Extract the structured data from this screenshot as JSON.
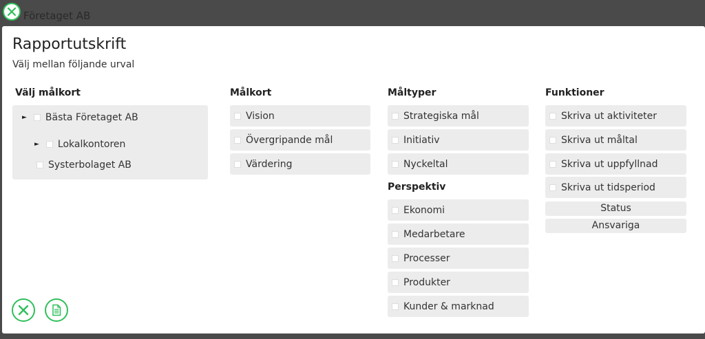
{
  "background": {
    "behind_text": "Företaget AB"
  },
  "dialog": {
    "title": "Rapportutskrift",
    "subtitle": "Välj mellan följande urval"
  },
  "colors": {
    "accent": "#2fbf5a",
    "panel": "#ececec",
    "overlay": "#4a4a4a"
  },
  "columns": {
    "scorecards": {
      "header": "Välj målkort",
      "tree": [
        {
          "label": "Bästa Företaget AB",
          "expandable": true,
          "checked": false
        },
        {
          "label": "Lokalkontoren",
          "expandable": true,
          "checked": false
        },
        {
          "label": "Systerbolaget AB",
          "expandable": false,
          "checked": false
        }
      ]
    },
    "malkort": {
      "header": "Målkort",
      "items": [
        "Vision",
        "Övergripande mål",
        "Värdering"
      ]
    },
    "maltyper": {
      "header": "Måltyper",
      "items": [
        "Strategiska mål",
        "Initiativ",
        "Nyckeltal"
      ]
    },
    "perspektiv": {
      "header": "Perspektiv",
      "items": [
        "Ekonomi",
        "Medarbetare",
        "Processer",
        "Produkter",
        "Kunder & marknad"
      ]
    },
    "funktioner": {
      "header": "Funktioner",
      "items": [
        "Skriva ut aktiviteter",
        "Skriva ut måltal",
        "Skriva ut uppfyllnad",
        "Skriva ut tidsperiod"
      ],
      "buttons": [
        "Status",
        "Ansvariga"
      ]
    }
  },
  "icons": {
    "close": "close-circle-icon",
    "print": "document-icon"
  }
}
